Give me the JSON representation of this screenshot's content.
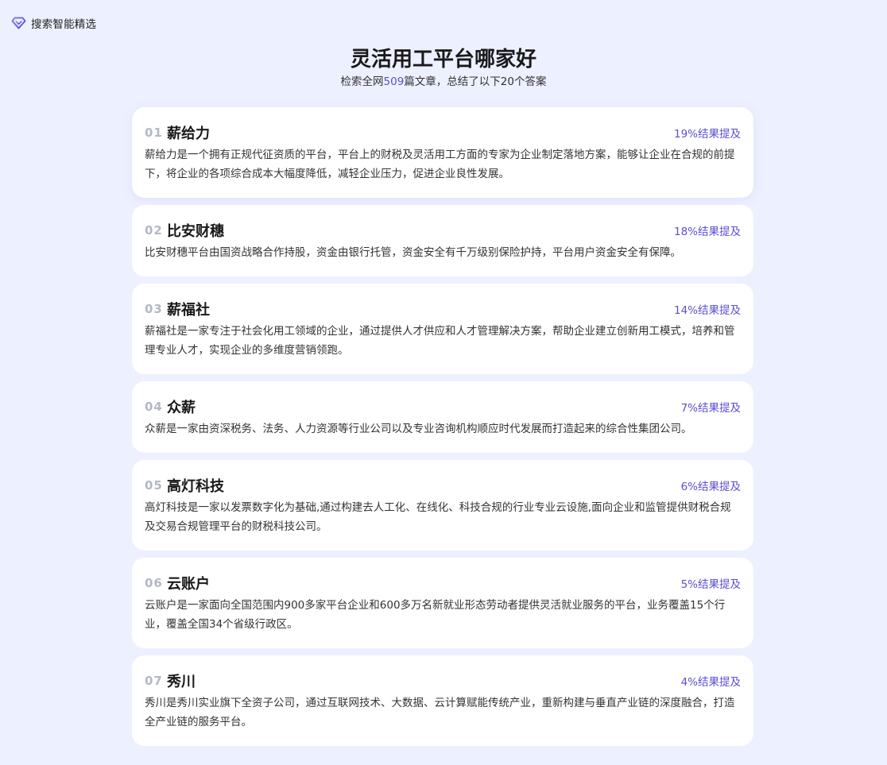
{
  "brand": {
    "label": "搜索智能精选",
    "icon": "diamond-icon",
    "accent": "#6b5fe0"
  },
  "header": {
    "title": "灵活用工平台哪家好",
    "subtitle_prefix": "检索全网",
    "article_count": "509",
    "subtitle_suffix": "篇文章，总结了以下20个答案"
  },
  "colors": {
    "background": "#edf0fe",
    "accent": "#5b4fd1",
    "rank": "#b4b8c6"
  },
  "results": [
    {
      "rank": "01",
      "name": "薪给力",
      "mention": "19%结果提及",
      "description": "薪给力是一个拥有正规代征资质的平台，平台上的财税及灵活用工方面的专家为企业制定落地方案，能够让企业在合规的前提下，将企业的各项综合成本大幅度降低，减轻企业压力，促进企业良性发展。"
    },
    {
      "rank": "02",
      "name": "比安财穗",
      "mention": "18%结果提及",
      "description": "比安财穗平台由国资战略合作持股，资金由银行托管，资金安全有千万级别保险护持，平台用户资金安全有保障。"
    },
    {
      "rank": "03",
      "name": "薪福社",
      "mention": "14%结果提及",
      "description": "薪福社是一家专注于社会化用工领域的企业，通过提供人才供应和人才管理解决方案，帮助企业建立创新用工模式，培养和管理专业人才，实现企业的多维度营销领跑。"
    },
    {
      "rank": "04",
      "name": "众薪",
      "mention": "7%结果提及",
      "description": "众薪是一家由资深税务、法务、人力资源等行业公司以及专业咨询机构顺应时代发展而打造起来的综合性集团公司。"
    },
    {
      "rank": "05",
      "name": "高灯科技",
      "mention": "6%结果提及",
      "description": "高灯科技是一家以发票数字化为基础,通过构建去人工化、在线化、科技合规的行业专业云设施,面向企业和监管提供财税合规及交易合规管理平台的财税科技公司。"
    },
    {
      "rank": "06",
      "name": "云账户",
      "mention": "5%结果提及",
      "description": "云账户是一家面向全国范围内900多家平台企业和600多万名新就业形态劳动者提供灵活就业服务的平台，业务覆盖15个行业，覆盖全国34个省级行政区。"
    },
    {
      "rank": "07",
      "name": "秀川",
      "mention": "4%结果提及",
      "description": "秀川是秀川实业旗下全资子公司，通过互联网技术、大数据、云计算赋能传统产业，重新构建与垂直产业链的深度融合，打造全产业链的服务平台。"
    }
  ]
}
